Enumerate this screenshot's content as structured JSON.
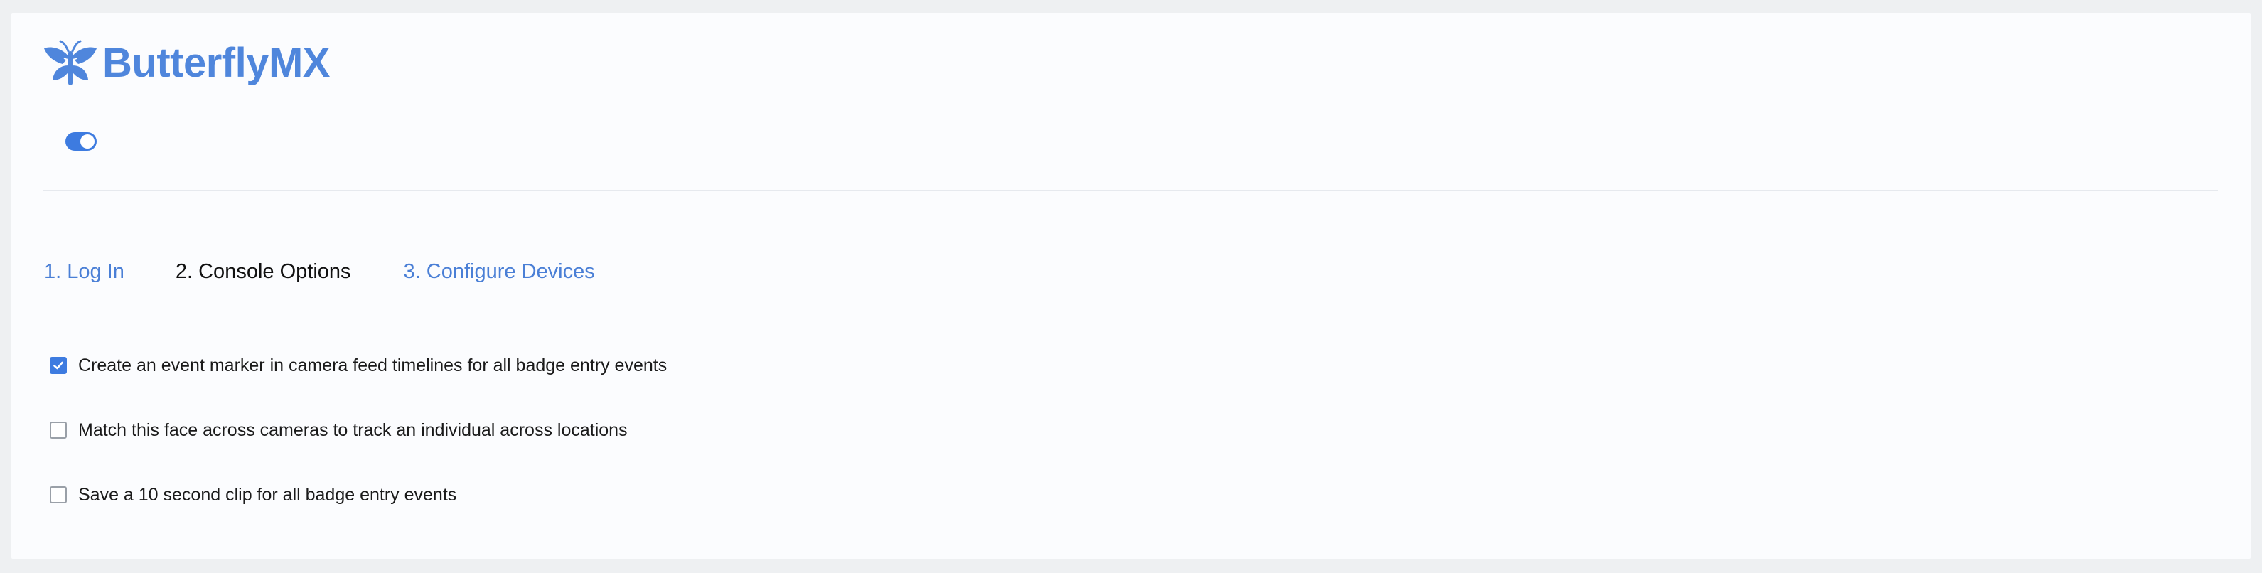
{
  "brand": {
    "logo_text": "ButterflyMX",
    "logo_icon": "butterfly-icon",
    "accent_color": "#4f86dc"
  },
  "toggle": {
    "state": "on",
    "color": "#3d7be0"
  },
  "steps": [
    {
      "label": "1. Log In",
      "state": "link"
    },
    {
      "label": "2. Console Options",
      "state": "current"
    },
    {
      "label": "3. Configure Devices",
      "state": "link"
    }
  ],
  "options": [
    {
      "label": "Create an event marker in camera feed timelines for all badge entry events",
      "checked": true
    },
    {
      "label": "Match this face across cameras to track an individual across locations",
      "checked": false
    },
    {
      "label": "Save a 10 second clip for all badge entry events",
      "checked": false
    }
  ]
}
